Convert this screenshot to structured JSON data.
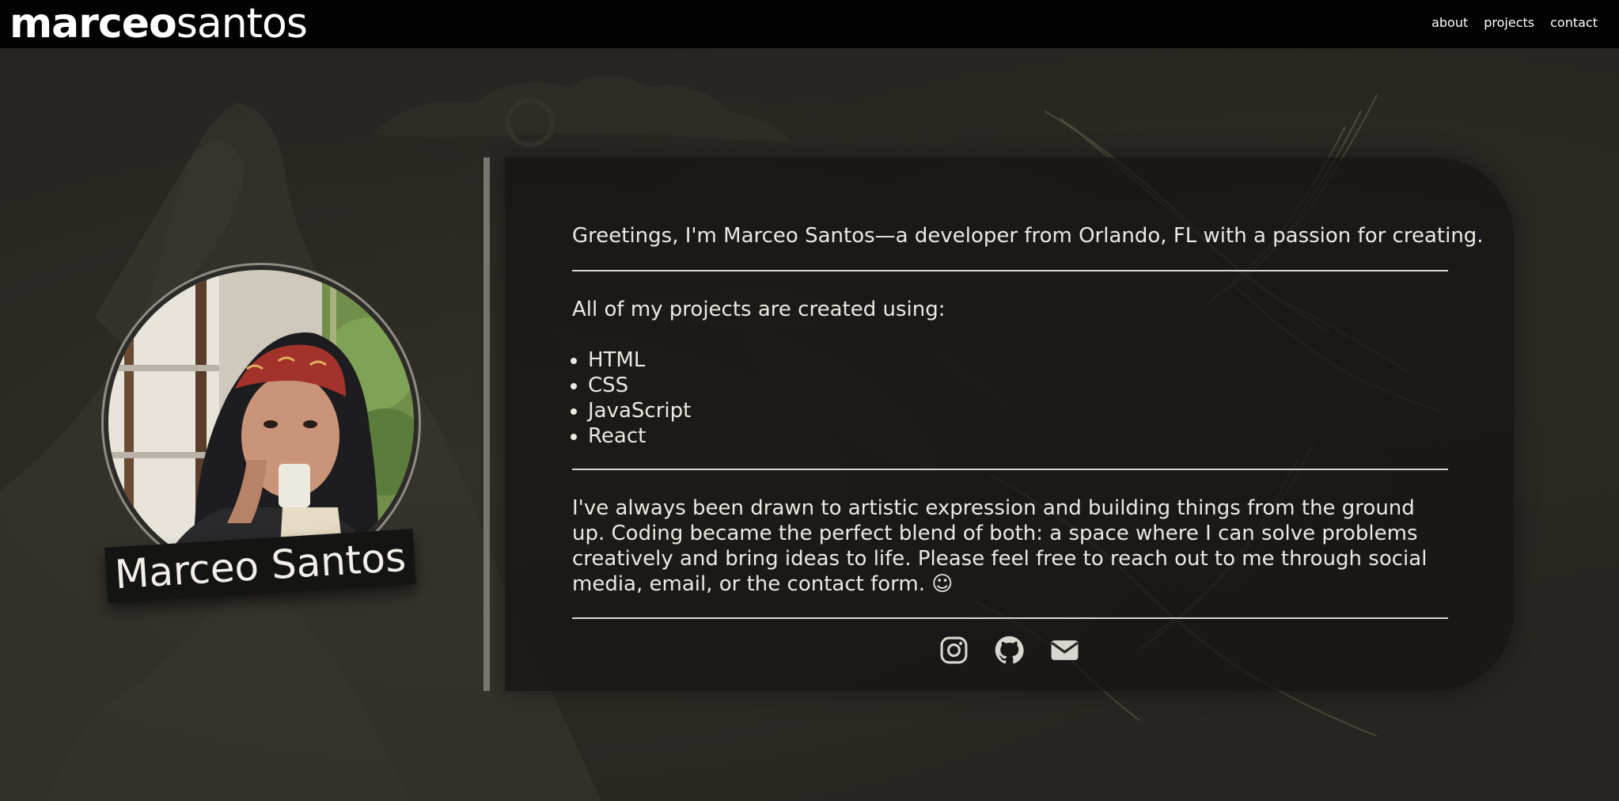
{
  "brand": {
    "bold": "marceo",
    "light": "santos"
  },
  "nav": {
    "links": [
      "about",
      "projects",
      "contact"
    ]
  },
  "profile": {
    "name": "Marceo Santos"
  },
  "about": {
    "greeting": "Greetings, I'm Marceo Santos—a developer from Orlando, FL with a passion for creating.",
    "tech_intro": "All of my projects are created using:",
    "tech": [
      "HTML",
      "CSS",
      "JavaScript",
      "React"
    ],
    "bio": "I've always been drawn to artistic expression and building things from the ground up. Coding became the perfect blend of both: a space where I can solve problems creatively and bring ideas to life. Please feel free to reach out to me through social media, email, or the contact form. ☺"
  },
  "social": {
    "icons": [
      "instagram-icon",
      "github-icon",
      "email-icon"
    ]
  },
  "colors": {
    "nav_bg": "#030303",
    "page_bg": "#272521",
    "card_bg": "#161513",
    "text": "#ece9e2",
    "divider": "#7b7874",
    "icon": "#d9d6cf"
  }
}
